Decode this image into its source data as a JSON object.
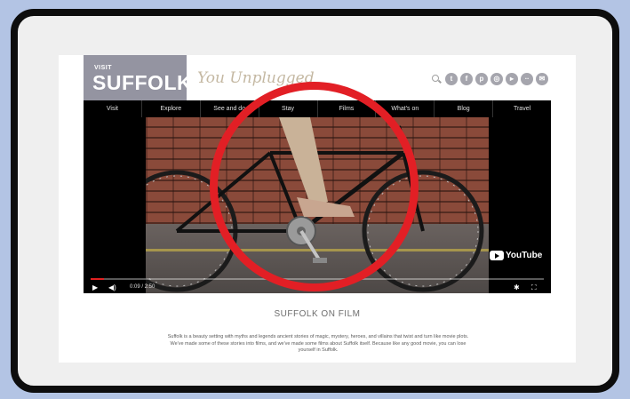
{
  "header": {
    "logo_small": "VISIT",
    "logo_big": "SUFFOLK",
    "tagline": "You Unplugged"
  },
  "social_icons": [
    "search-icon",
    "twitter-icon",
    "facebook-icon",
    "pinterest-icon",
    "instagram-icon",
    "youtube-icon",
    "flickr-icon",
    "email-icon"
  ],
  "nav": {
    "items": [
      "Visit",
      "Explore",
      "See and do",
      "Stay",
      "Films",
      "What's on",
      "Blog",
      "Travel"
    ]
  },
  "video": {
    "time": "0:09 / 2:50",
    "brand": "YouTube",
    "progress_fraction": 0.03
  },
  "content": {
    "section_title": "SUFFOLK ON FILM",
    "body": "Suffolk is a beauty setting with myths and legends ancient stories of magic, mystery, heroes, and villains that twist and turn like movie plots. We've made some of these stories into films, and we've made some films about Suffolk itself. Because like any good movie, you can lose yourself in Suffolk."
  },
  "colors": {
    "background": "#b3c4e4",
    "frame": "#0d0d0d",
    "highlight": "#e21f25",
    "logo_block": "#9494a1"
  }
}
